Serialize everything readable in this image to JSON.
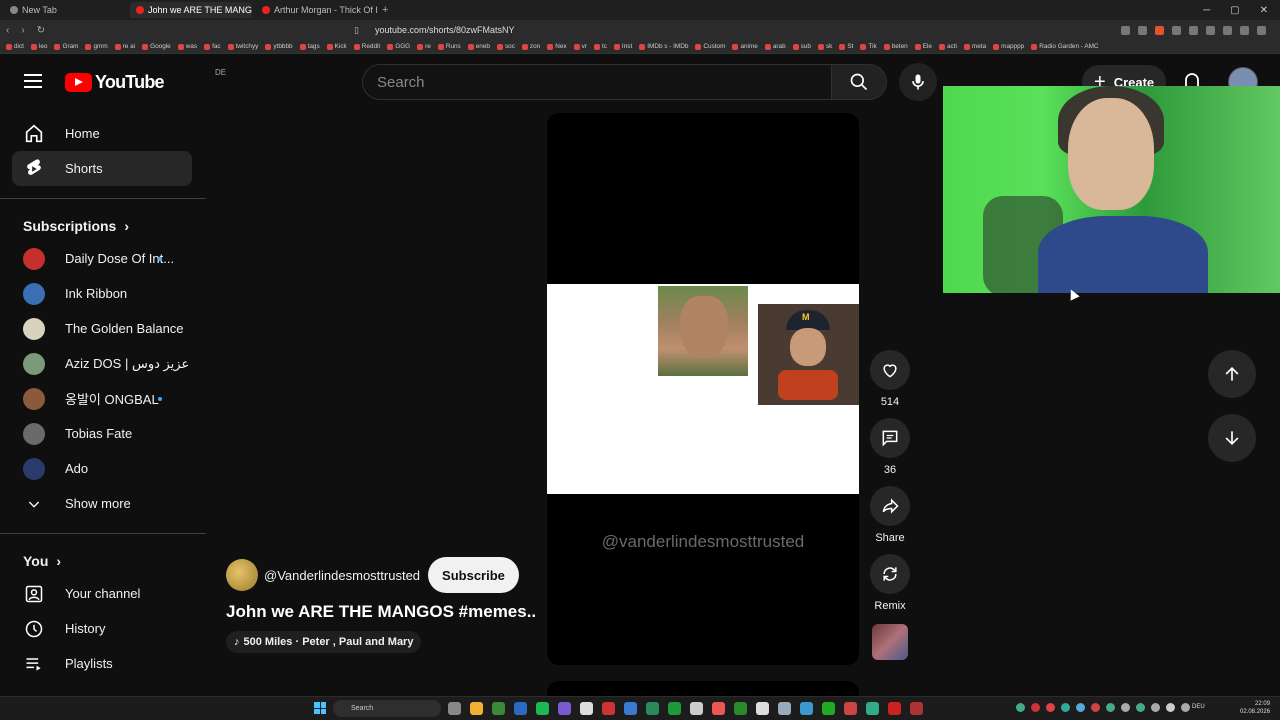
{
  "browser": {
    "tabs": [
      {
        "label": "New Tab",
        "active": false
      },
      {
        "label": "John we ARE THE MANGOS #",
        "active": true
      },
      {
        "label": "Arthur Morgan - Thick Of It (ft. John",
        "active": false
      }
    ],
    "url": "youtube.com/shorts/80zwFMatsNY",
    "bookmarks": [
      "dict",
      "leo",
      "Gram",
      "gmm",
      "re ai",
      "Google",
      "was",
      "fac",
      "twitchyy",
      "ytbbbb",
      "tags",
      "Kick",
      "Reddit",
      "GGG",
      "re",
      "Runs",
      "eneb",
      "soc",
      "zon",
      "Nex",
      "vr",
      "tc",
      "Inst",
      "IMDb s - IMDb",
      "Custom",
      "anime",
      "arab",
      "sub",
      "sk",
      "St",
      "Tik",
      "beten",
      "Ele",
      "acti",
      "meta",
      "mapppp",
      "Radio Garden - AMC"
    ]
  },
  "header": {
    "logo_text": "YouTube",
    "country_code": "DE",
    "search_placeholder": "Search",
    "create_label": "Create"
  },
  "sidebar": {
    "main": [
      {
        "label": "Home",
        "icon": "home-icon"
      },
      {
        "label": "Shorts",
        "icon": "shorts-icon",
        "active": true
      }
    ],
    "subscriptions_title": "Subscriptions",
    "subscriptions": [
      {
        "label": "Daily Dose Of Int...",
        "color": "#c4302b",
        "live": true
      },
      {
        "label": "Ink Ribbon",
        "color": "#3a6fb5",
        "live": false
      },
      {
        "label": "The Golden Balance",
        "color": "#d9d2bf",
        "live": false
      },
      {
        "label": "Aziz DOS | عزيز دوس",
        "color": "#7a9a7a",
        "live": false
      },
      {
        "label": "옹발이 ONGBAL",
        "color": "#8a5a3a",
        "live": true
      },
      {
        "label": "Tobias Fate",
        "color": "#6a6a6a",
        "live": false
      },
      {
        "label": "Ado",
        "color": "#2a3a6a",
        "live": false
      }
    ],
    "show_more": "Show more",
    "you_title": "You",
    "you_items": [
      {
        "label": "Your channel",
        "icon": "channel-icon"
      },
      {
        "label": "History",
        "icon": "history-icon"
      },
      {
        "label": "Playlists",
        "icon": "playlists-icon"
      }
    ]
  },
  "short": {
    "watermark": "@vanderlindesmosttrusted",
    "channel": "@Vanderlindesmosttrusted",
    "subscribe_label": "Subscribe",
    "title": "John we ARE THE MANGOS #memes...",
    "music": "500 Miles · Peter , Paul and Mary"
  },
  "actions": {
    "likes": "514",
    "comments": "36",
    "share_label": "Share",
    "remix_label": "Remix"
  },
  "taskbar": {
    "search_label": "Search",
    "lang": "DEU",
    "time": "22:09",
    "date": "02.08.2026"
  }
}
